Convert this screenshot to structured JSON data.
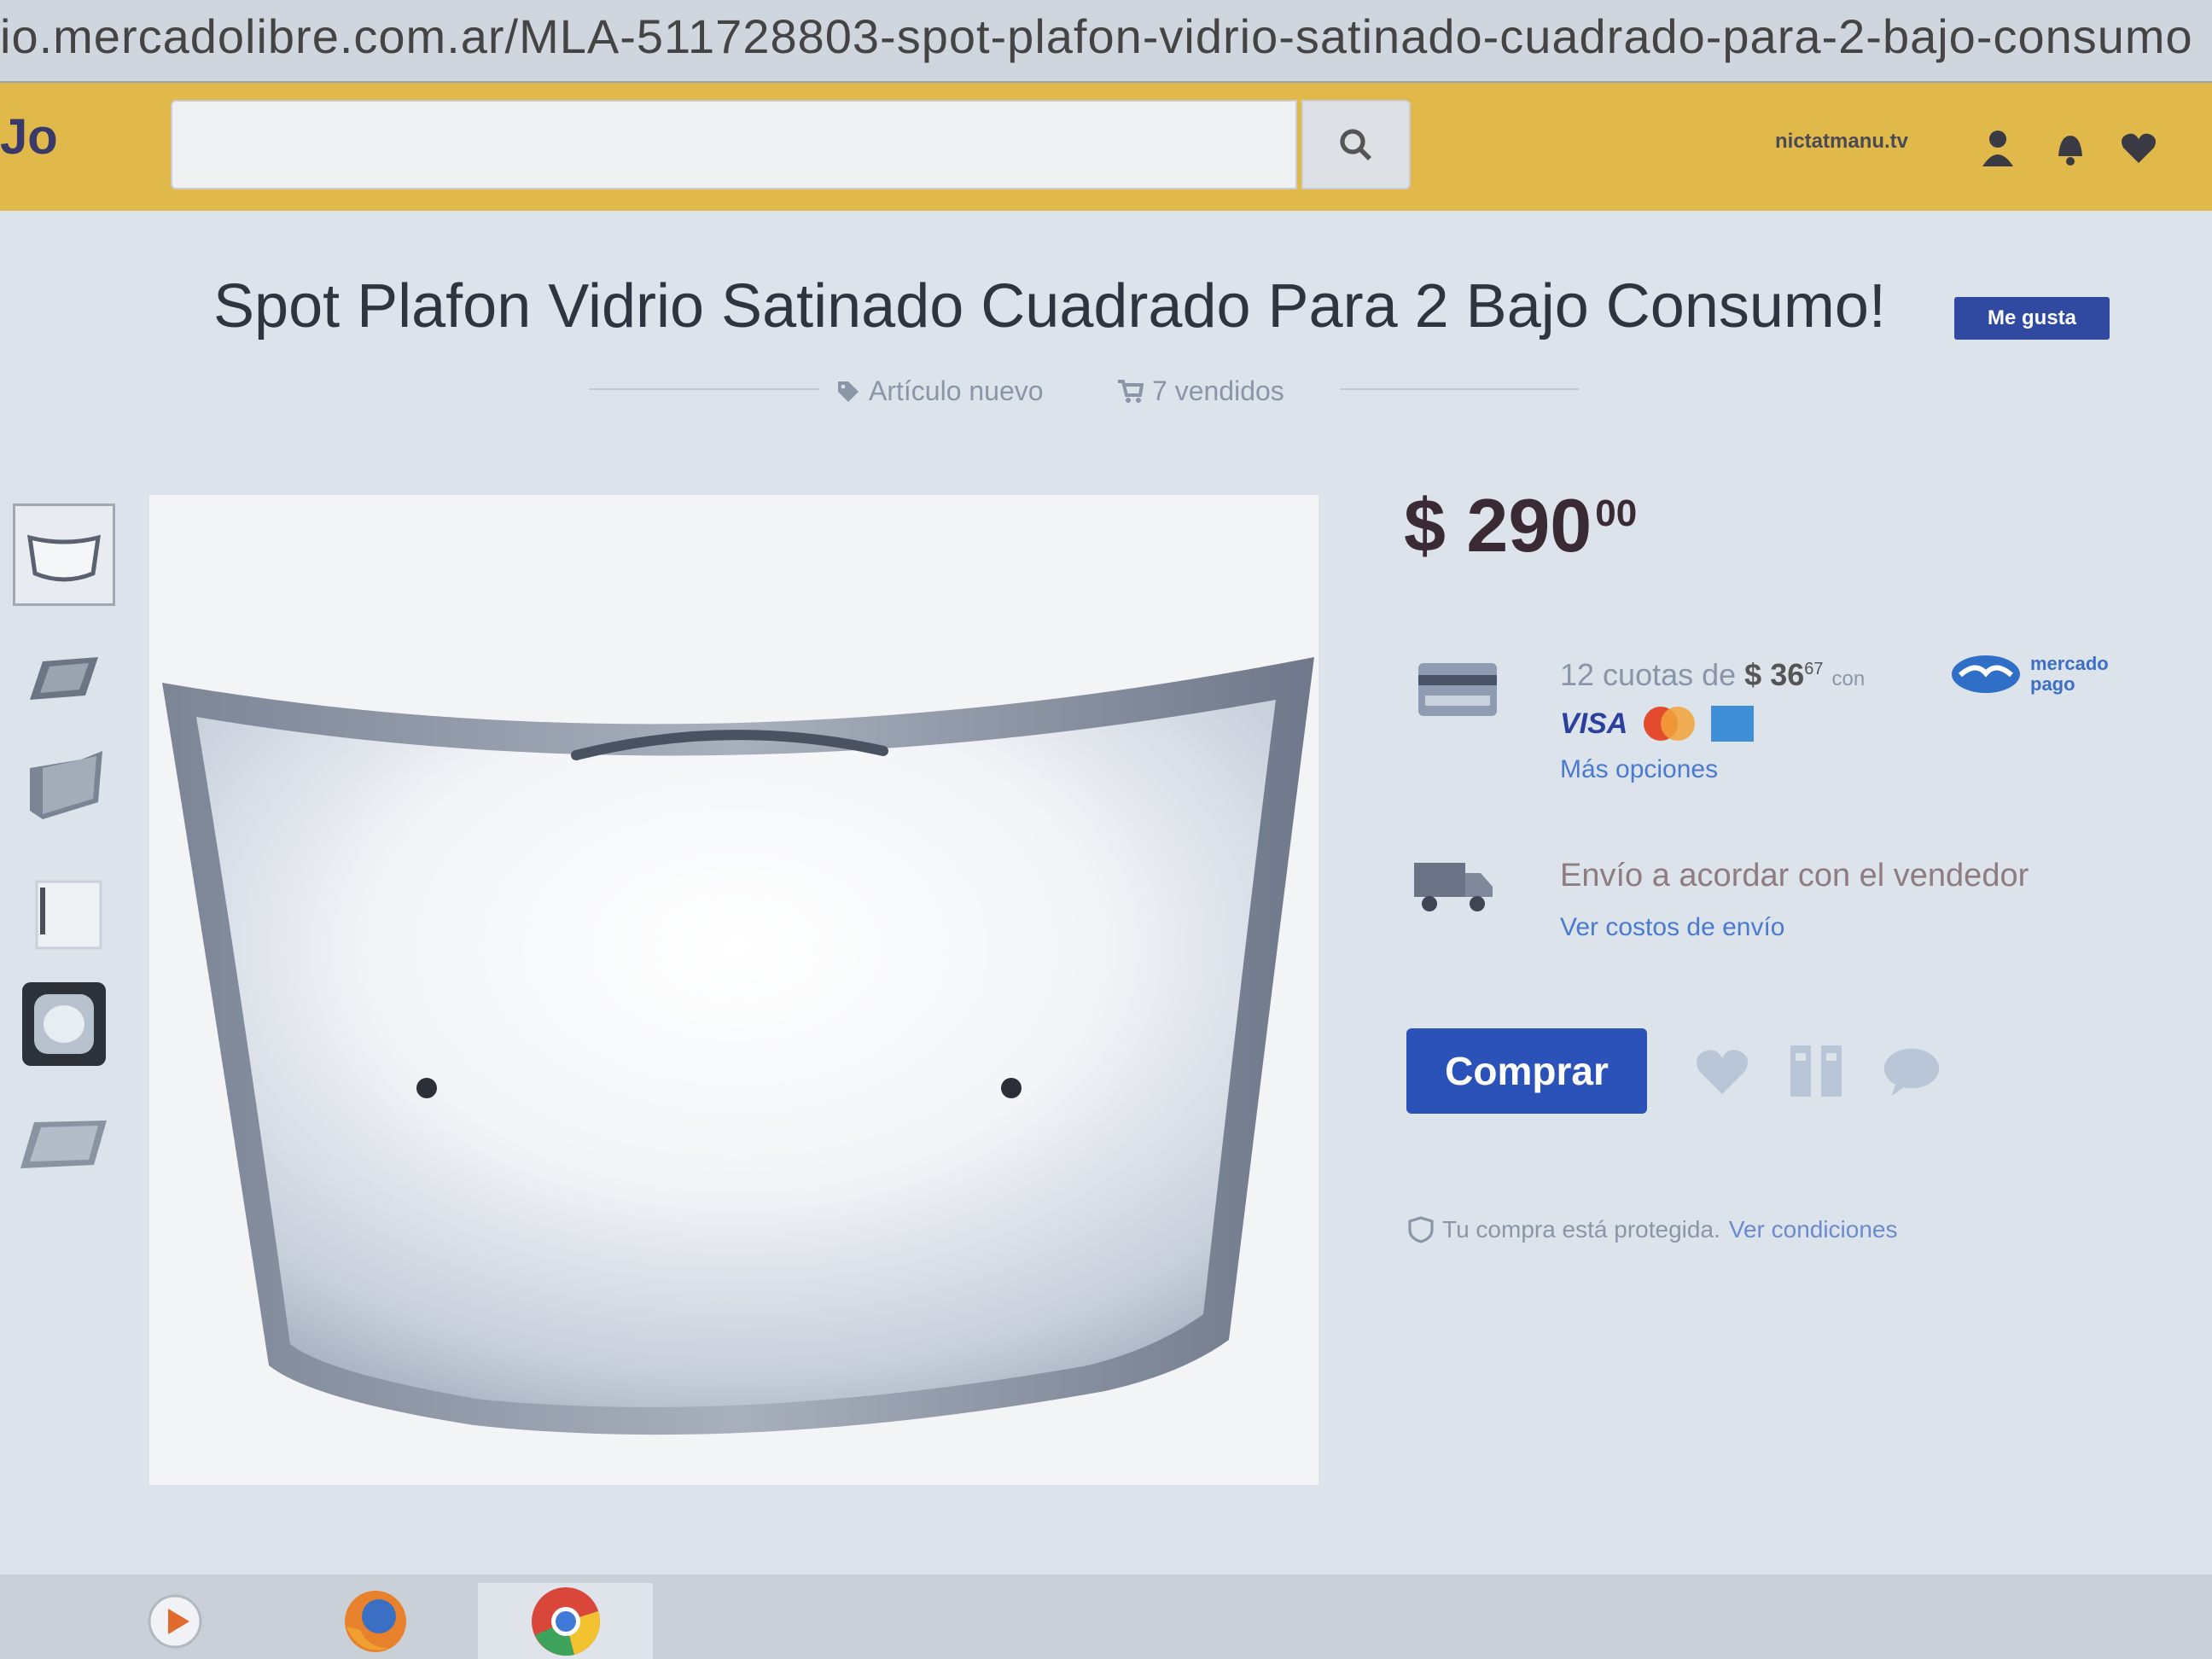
{
  "browser": {
    "url": "io.mercadolibre.com.ar/MLA-511728803-spot-plafon-vidrio-satinado-cuadrado-para-2-bajo-consumo"
  },
  "header": {
    "logo_text": "Jo",
    "search_placeholder": "",
    "user_name": "nictatmanu.tv"
  },
  "product": {
    "title": "Spot Plafon Vidrio Satinado Cuadrado Para 2 Bajo Consumo!",
    "badge": "Me gusta",
    "condition": "Artículo nuevo",
    "sold": "7 vendidos",
    "price_currency": "$",
    "price_integer": "290",
    "price_cents": "00"
  },
  "payment": {
    "installments_prefix": "12 cuotas de",
    "installments_amount": "$ 36",
    "installments_cents": "67",
    "installments_suffix": "con",
    "mercadopago_line1": "mercado",
    "mercadopago_line2": "pago",
    "visa_label": "VISA",
    "more_options": "Más opciones"
  },
  "shipping": {
    "text": "Envío a acordar con el vendedor",
    "link": "Ver costos de envío"
  },
  "actions": {
    "buy_label": "Comprar"
  },
  "protection": {
    "text": "Tu compra está protegida.",
    "link": "Ver condiciones"
  },
  "colors": {
    "header_yellow": "#e0b94a",
    "buy_blue": "#2a52b8",
    "link_blue": "#4a7ad0"
  },
  "icons": [
    "search-icon",
    "user-icon",
    "bell-icon",
    "heart-icon",
    "tag-icon",
    "cart-icon",
    "credit-card-icon",
    "truck-icon",
    "favorite-icon",
    "compare-icon",
    "question-icon",
    "shield-icon",
    "firefox-icon",
    "chrome-icon",
    "media-player-icon"
  ]
}
